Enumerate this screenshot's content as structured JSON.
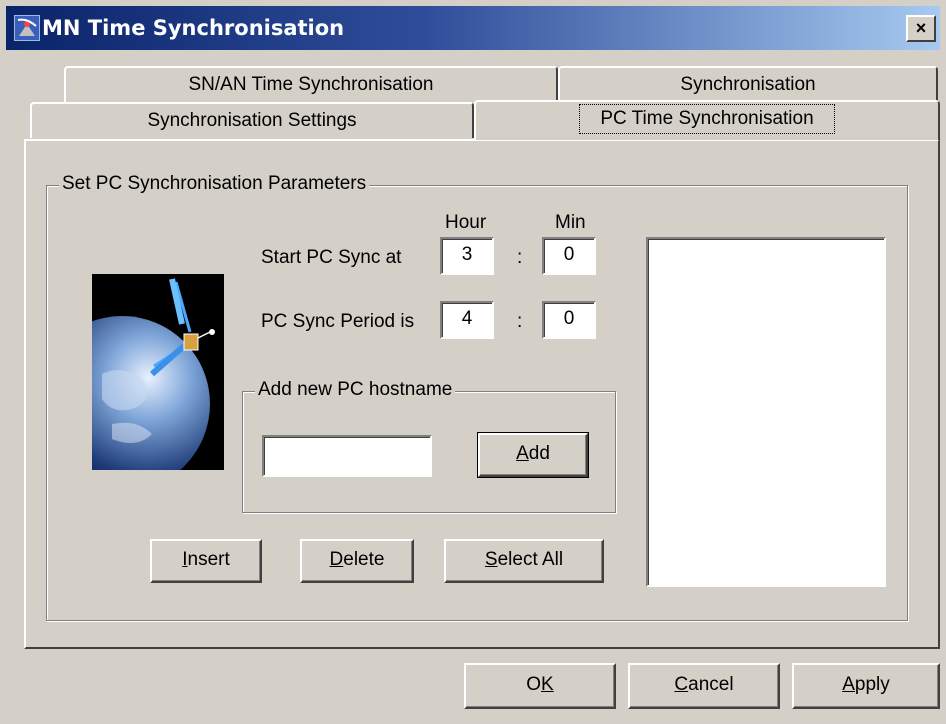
{
  "window": {
    "title": "MN Time Synchronisation",
    "close_label": "×"
  },
  "tabs": {
    "sn_an": "SN/AN Time Synchronisation",
    "synchronisation": "Synchronisation",
    "sync_settings": "Synchronisation Settings",
    "pc_time": "PC Time Synchronisation"
  },
  "group": {
    "title": "Set PC Synchronisation Parameters",
    "hour_label": "Hour",
    "min_label": "Min",
    "start_label": "Start PC Sync at",
    "start_hour": "3",
    "start_min": "0",
    "period_label": "PC Sync Period is",
    "period_hour": "4",
    "period_min": "0",
    "colon": ":"
  },
  "hostname": {
    "title": "Add new PC hostname",
    "value": "",
    "add_mnemonic": "A",
    "add_rest": "dd"
  },
  "actions": {
    "insert_mnemonic": "I",
    "insert_rest": "nsert",
    "delete_mnemonic": "D",
    "delete_rest": "elete",
    "selectall_mnemonic": "S",
    "selectall_rest": "elect All"
  },
  "footer": {
    "ok_prefix": "O",
    "ok_mnemonic": "K",
    "cancel_mnemonic": "C",
    "cancel_rest": "ancel",
    "apply_mnemonic": "A",
    "apply_rest": "pply"
  },
  "colors": {
    "face": "#d4d0c8",
    "title_start": "#0a246a",
    "title_end": "#a6caf0"
  }
}
